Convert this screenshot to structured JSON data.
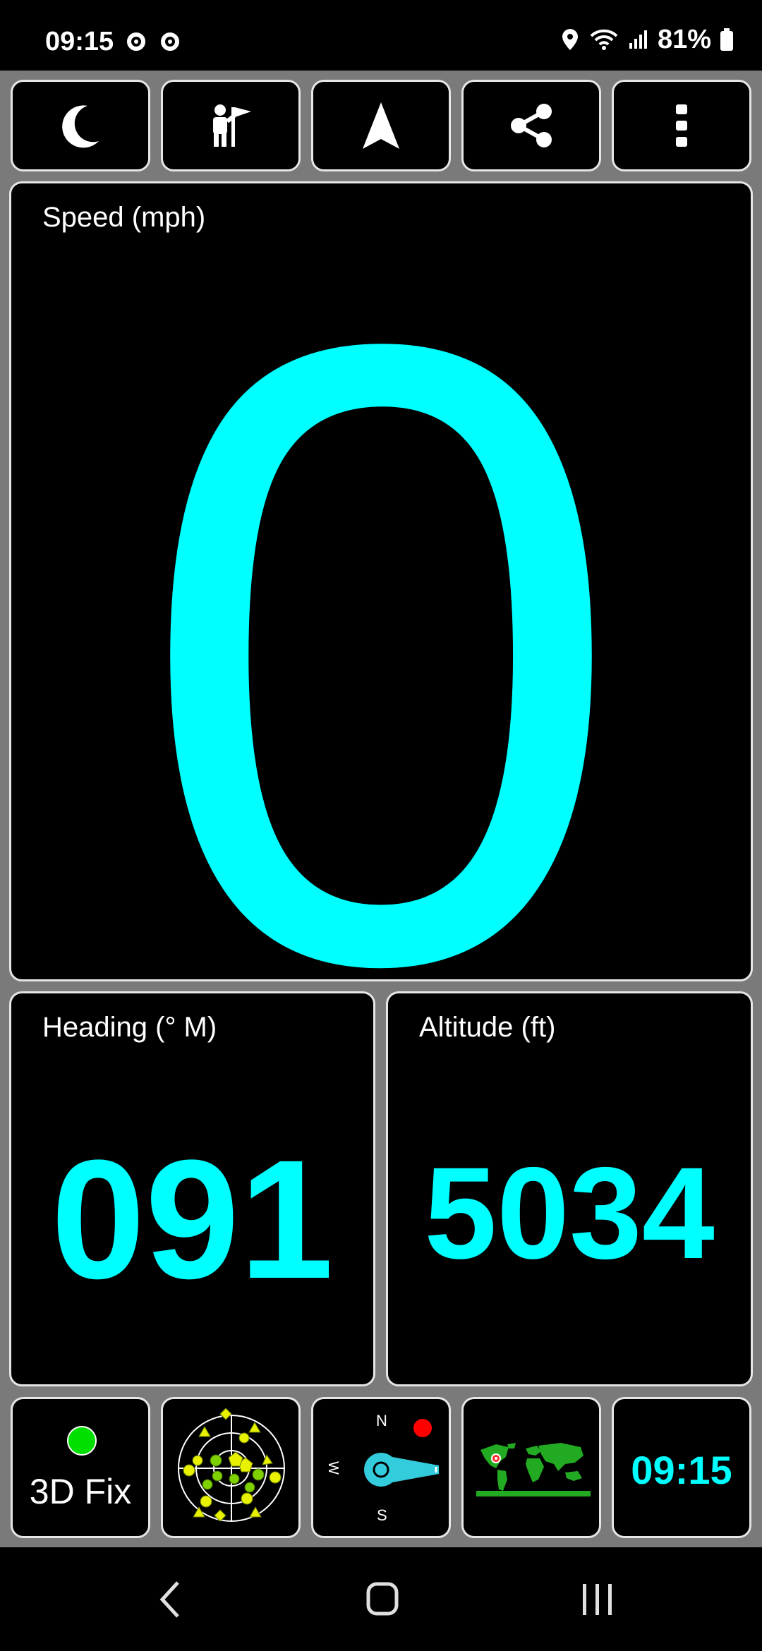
{
  "status_bar": {
    "time": "09:15",
    "battery_percent": "81%",
    "icons": [
      "notification-ring-icon",
      "notification-ring-icon",
      "location-pin-icon",
      "wifi-icon",
      "signal-icon",
      "battery-icon"
    ]
  },
  "toolbar": {
    "buttons": [
      {
        "icon": "night-mode-moon-icon"
      },
      {
        "icon": "waypoint-person-flag-icon"
      },
      {
        "icon": "navigation-arrow-icon"
      },
      {
        "icon": "share-icon"
      },
      {
        "icon": "more-vertical-icon"
      }
    ]
  },
  "speed": {
    "label": "Speed (mph)",
    "value": "0"
  },
  "heading": {
    "label": "Heading (° M)",
    "value": "091"
  },
  "altitude": {
    "label": "Altitude (ft)",
    "value": "5034"
  },
  "bottom_tiles": {
    "fix": {
      "status": "3D Fix",
      "indicator_color": "#00e000"
    },
    "sky_view": {
      "icon": "satellite-sky-plot-icon"
    },
    "compass": {
      "n": "N",
      "s": "S",
      "w": "W"
    },
    "world_map": {
      "icon": "world-map-icon"
    },
    "clock": {
      "time": "09:15"
    }
  },
  "colors": {
    "accent": "#00ffff",
    "tile_border": "#e6e6e6",
    "background_gray": "#7a7a7a"
  }
}
